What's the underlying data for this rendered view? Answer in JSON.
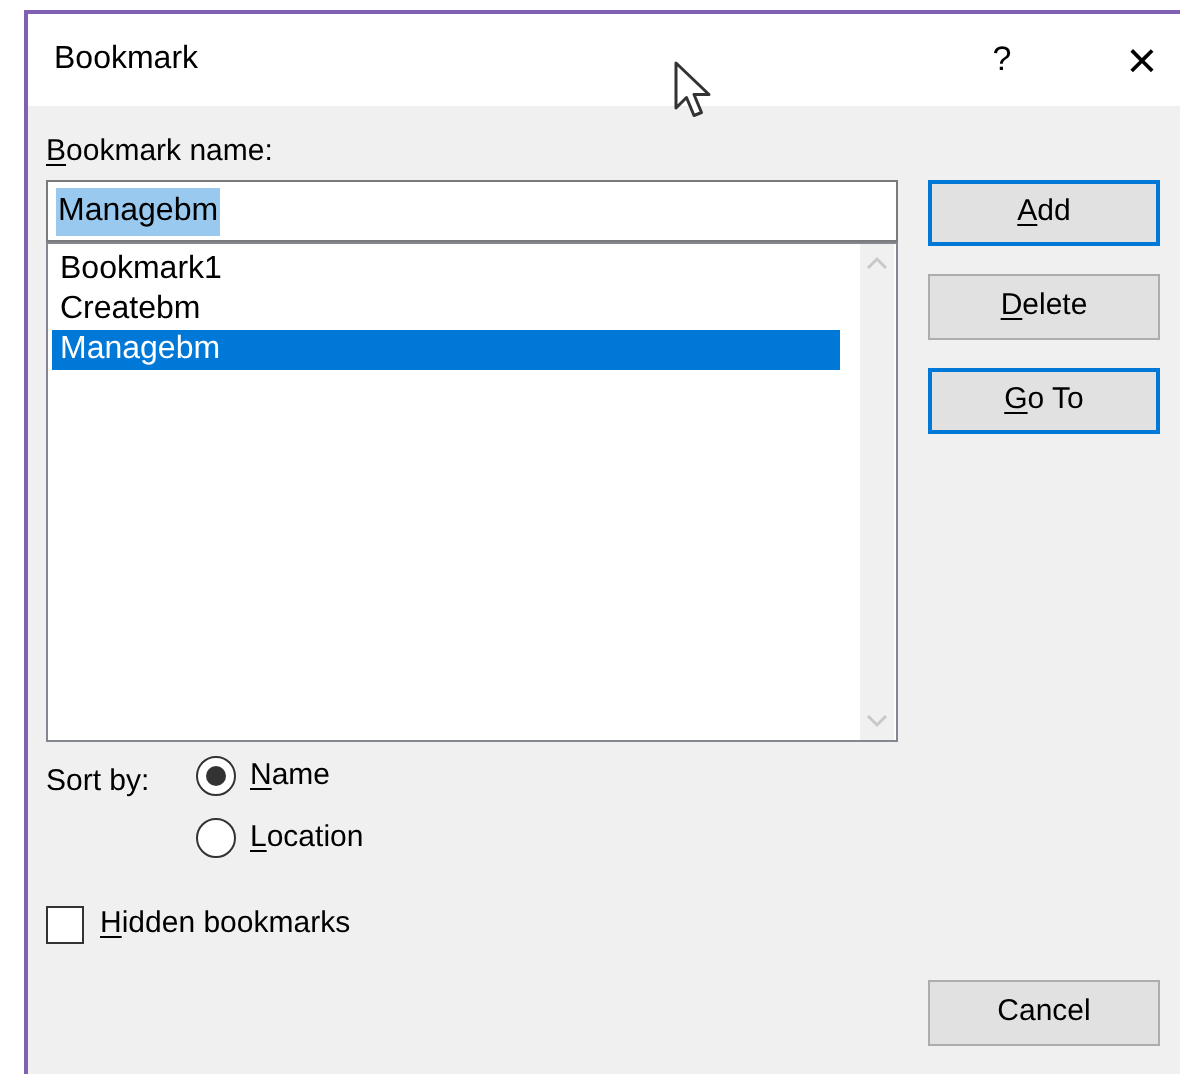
{
  "window": {
    "title": "Bookmark",
    "help": "?",
    "close": "×"
  },
  "name_field": {
    "label": "Bookmark name:",
    "mnemonic": true,
    "value": "Managebm",
    "value_selected": true
  },
  "list": [
    {
      "label": "Bookmark1",
      "selected": false
    },
    {
      "label": "Createbm",
      "selected": false
    },
    {
      "label": "Managebm",
      "selected": true
    }
  ],
  "buttons": [
    {
      "label": "Add",
      "mnemonic": true,
      "default": true
    },
    {
      "label": "Delete",
      "mnemonic": true,
      "default": false
    },
    {
      "label": "Go To",
      "mnemonic": true,
      "default": true
    }
  ],
  "sort": {
    "label": "Sort by:",
    "options": [
      {
        "label": "Name",
        "mnemonic": true,
        "selected": true
      },
      {
        "label": "Location",
        "mnemonic": true,
        "selected": false
      }
    ]
  },
  "hidden_bookmarks": {
    "label": "Hidden bookmarks",
    "mnemonic": true,
    "checked": false
  },
  "cancel": {
    "label": "Cancel",
    "mnemonic": false
  }
}
